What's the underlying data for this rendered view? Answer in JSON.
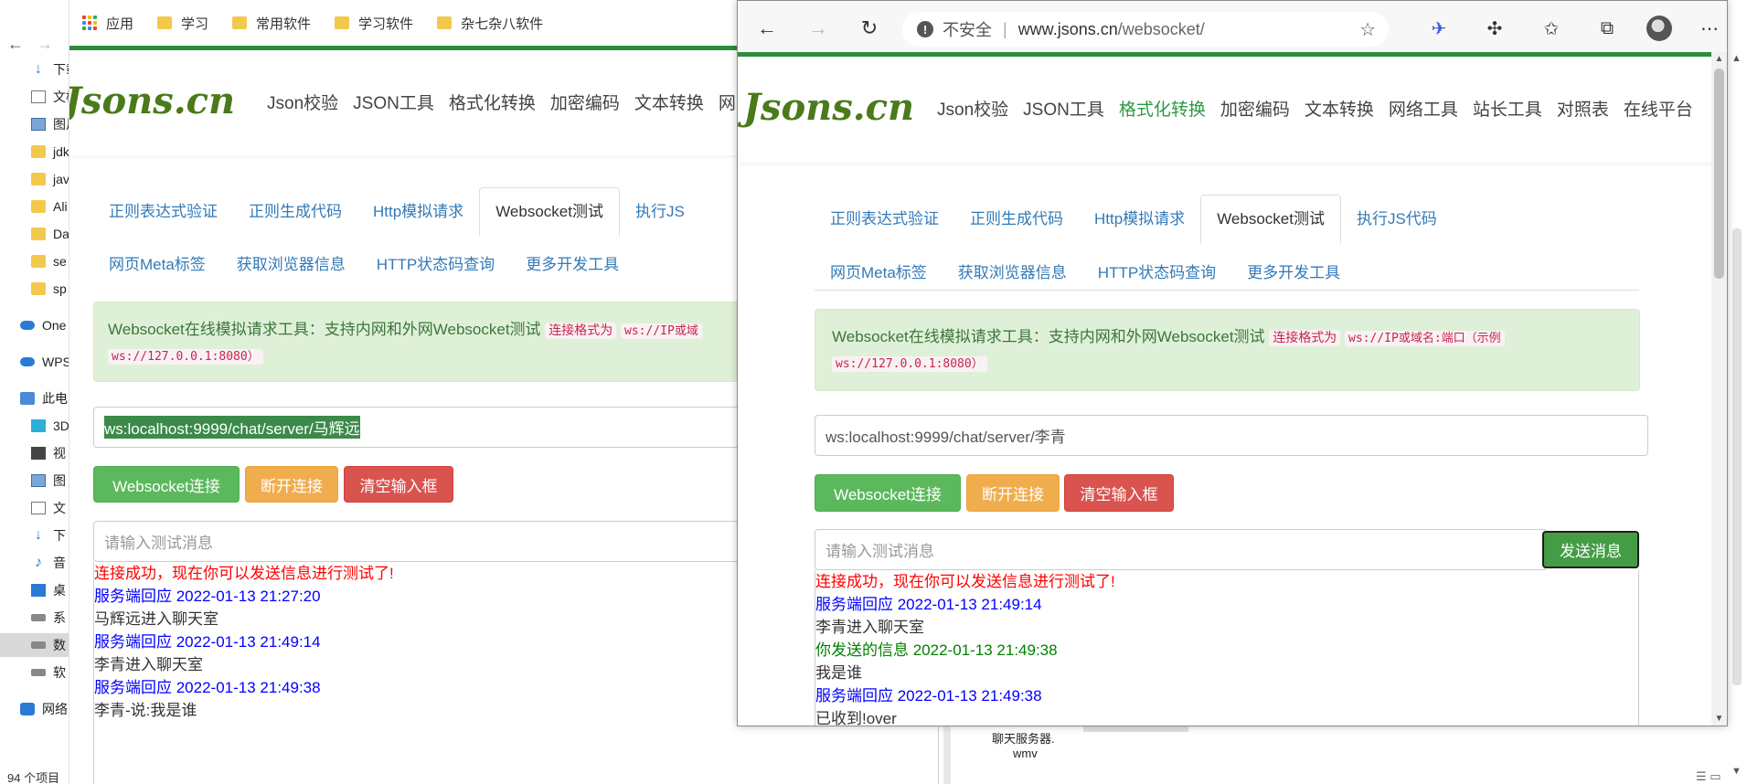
{
  "explorer": {
    "items": [
      {
        "icon": "download-icon",
        "label": "下载"
      },
      {
        "icon": "document-icon",
        "label": "文档"
      },
      {
        "icon": "image-icon",
        "label": "图片"
      },
      {
        "icon": "folder-icon",
        "label": "jdk"
      },
      {
        "icon": "folder-icon",
        "label": "java"
      },
      {
        "icon": "folder-icon",
        "label": "Ali"
      },
      {
        "icon": "folder-icon",
        "label": "Da"
      },
      {
        "icon": "folder-icon",
        "label": "se"
      },
      {
        "icon": "folder-icon",
        "label": "sp"
      },
      {
        "icon": "onedrive-icon",
        "label": "One"
      },
      {
        "icon": "wps-cloud-icon",
        "label": "WPS"
      },
      {
        "icon": "pc-icon",
        "label": "此电"
      },
      {
        "icon": "cube-3d-icon",
        "label": "3D"
      },
      {
        "icon": "video-icon",
        "label": "视"
      },
      {
        "icon": "image-icon",
        "label": "图"
      },
      {
        "icon": "document-icon",
        "label": "文"
      },
      {
        "icon": "download-icon",
        "label": "下"
      },
      {
        "icon": "music-icon",
        "label": "音"
      },
      {
        "icon": "desktop-icon",
        "label": "桌"
      },
      {
        "icon": "drive-icon",
        "label": "系"
      },
      {
        "icon": "drive-icon",
        "label": "数"
      },
      {
        "icon": "drive-icon",
        "label": "软"
      },
      {
        "icon": "network-icon",
        "label": "网络"
      }
    ],
    "status": "94 个项目"
  },
  "bg_browser": {
    "bookmarks": [
      {
        "icon": "apps-grid-icon",
        "label": "应用"
      },
      {
        "icon": "folder-icon",
        "label": "学习"
      },
      {
        "icon": "folder-icon",
        "label": "常用软件"
      },
      {
        "icon": "folder-icon",
        "label": "学习软件"
      },
      {
        "icon": "folder-icon",
        "label": "杂七杂八软件"
      }
    ],
    "nav_partial": "网",
    "tab_partial": "执行JS",
    "alert_code_partial": "ws://IP或域",
    "url_value": "ws:localhost:9999/chat/server/马辉远",
    "log": [
      {
        "color": "red",
        "text": "连接成功，现在你可以发送信息进行测试了!"
      },
      {
        "color": "blue",
        "text": "服务端回应 2022-01-13 21:27:20"
      },
      {
        "color": "black",
        "text": "马辉远进入聊天室"
      },
      {
        "color": "blue",
        "text": "服务端回应 2022-01-13 21:49:14"
      },
      {
        "color": "black",
        "text": "李青进入聊天室"
      },
      {
        "color": "blue",
        "text": "服务端回应 2022-01-13 21:49:38"
      },
      {
        "color": "black",
        "text": "李青-说:我是谁"
      }
    ]
  },
  "site": {
    "logo": "Jsons.cn",
    "nav": [
      "Json校验",
      "JSON工具",
      "格式化转换",
      "加密编码",
      "文本转换",
      "网络工具",
      "站长工具",
      "对照表",
      "在线平台"
    ],
    "tabs_row1": [
      "正则表达式验证",
      "正则生成代码",
      "Http模拟请求",
      "Websocket测试",
      "执行JS代码"
    ],
    "tabs_row2": [
      "网页Meta标签",
      "获取浏览器信息",
      "HTTP状态码查询",
      "更多开发工具"
    ],
    "alert_text": "Websocket在线模拟请求工具：支持内网和外网Websocket测试",
    "alert_label": "连接格式为",
    "alert_code1": "ws://IP或域名:端口（示例",
    "alert_code2": "ws://127.0.0.1:8080）",
    "buttons": {
      "connect": "Websocket连接",
      "disconnect": "断开连接",
      "clear": "清空输入框",
      "send": "发送消息"
    },
    "message_placeholder": "请输入测试消息"
  },
  "fg_browser": {
    "insecure_label": "不安全",
    "url_host": "www.jsons.cn",
    "url_path": "/websocket/",
    "url_value": "ws:localhost:9999/chat/server/李青",
    "log": [
      {
        "color": "red",
        "text": "连接成功，现在你可以发送信息进行测试了!"
      },
      {
        "color": "blue",
        "text": "服务端回应 2022-01-13 21:49:14"
      },
      {
        "color": "black",
        "text": "李青进入聊天室"
      },
      {
        "color": "green",
        "text": "你发送的信息 2022-01-13 21:49:38"
      },
      {
        "color": "black",
        "text": "我是谁"
      },
      {
        "color": "blue",
        "text": "服务端回应 2022-01-13 21:49:38"
      },
      {
        "color": "black",
        "text": "已收到!over"
      }
    ]
  },
  "right_strip": {
    "line1": "聊天服务器.",
    "line2": "wmv"
  },
  "colors": {
    "site_green": "#2d8c3c",
    "active_nav": "#2c9a42",
    "link_blue": "#337ab7",
    "log_red": "#ff0000",
    "log_blue": "#0000ff",
    "log_green": "#008000"
  }
}
